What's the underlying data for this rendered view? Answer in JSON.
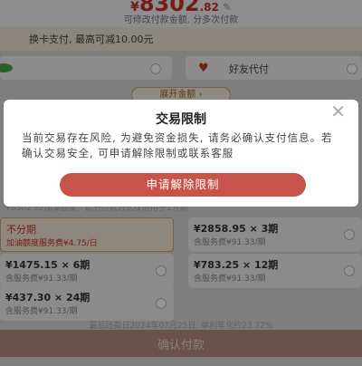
{
  "header": {
    "currency": "¥",
    "amount_main": "8302",
    "amount_cents": ".82",
    "subtitle": "可修改付款金额, 分多次付款"
  },
  "swap_banner": {
    "text": "换卡支付, 最高可减10.00元"
  },
  "payment_options": {
    "friend_pay_label": "好友代付"
  },
  "amount_toggle": {
    "label": "展开金额 ›"
  },
  "ghost_line": "¥8302.82加油额度 - 此分付款方式仅适用于1分期",
  "installments": [
    {
      "amount": "不分期",
      "fee": "加油额度服务费¥4.75/日",
      "selected": true
    },
    {
      "amount": "¥2858.95 × 3期",
      "fee": "含服务费¥91.33/期",
      "selected": false
    },
    {
      "amount": "¥1475.15 × 6期",
      "fee": "含服务费¥91.33/期",
      "selected": false
    },
    {
      "amount": "¥783.25 × 12期",
      "fee": "含服务费¥91.33/期",
      "selected": false
    },
    {
      "amount": "¥437.30 × 24期",
      "fee": "含服务费¥91.33/期",
      "selected": false
    }
  ],
  "note": "最后还款日2024年07月25日, 单利年化约23.72%",
  "confirm_label": "确认付款",
  "dialog": {
    "title": "交易限制",
    "close_glyph": "✕",
    "message": "当前交易存在风险, 为避免资金损失, 请务必确认支付信息。若确认交易安全, 可申请解除限制或联系客服",
    "button_label": "申请解除限制"
  },
  "colors": {
    "accent_red": "#c8534a",
    "price_red": "#c8322a",
    "mask": "rgba(0,0,0,0.42)"
  }
}
